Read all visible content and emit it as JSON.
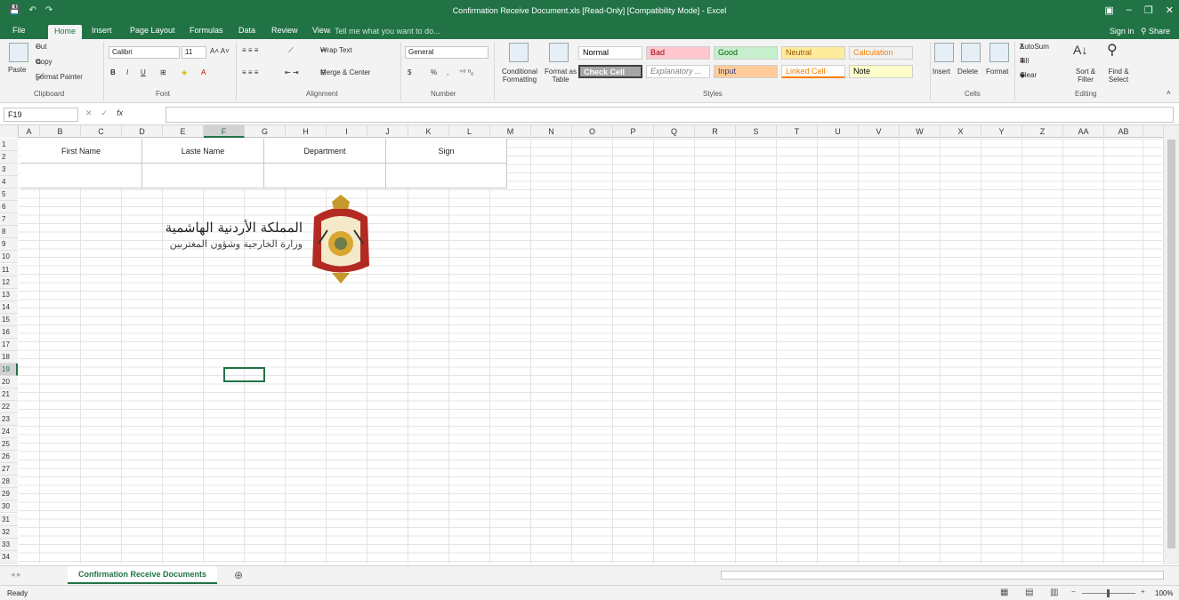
{
  "window": {
    "title": "Confirmation Receive Document.xls  [Read-Only]  [Compatibility Mode] - Excel"
  },
  "qat": {
    "save": "💾",
    "undo": "↶",
    "redo": "↷"
  },
  "tabs": [
    "File",
    "Home",
    "Insert",
    "Page Layout",
    "Formulas",
    "Data",
    "Review",
    "View"
  ],
  "tell_me": "Tell me what you want to do...",
  "account": {
    "signin": "Sign in",
    "share": "Share"
  },
  "ribbon": {
    "clipboard": {
      "paste": "Paste",
      "cut": "Cut",
      "copy": "Copy",
      "format_painter": "Format Painter",
      "label": "Clipboard"
    },
    "font": {
      "name": "Calibri",
      "size": "11",
      "bold": "B",
      "italic": "I",
      "underline": "U",
      "label": "Font"
    },
    "alignment": {
      "wrap": "Wrap Text",
      "merge": "Merge & Center",
      "label": "Alignment"
    },
    "number": {
      "format": "General",
      "currency": "$",
      "percent": "%",
      "comma": ",",
      "label": "Number"
    },
    "styles_group": {
      "conditional": "Conditional Formatting",
      "format_table": "Format as Table",
      "items": [
        {
          "name": "Normal",
          "bg": "#ffffff",
          "fg": "#000000"
        },
        {
          "name": "Bad",
          "bg": "#ffc7ce",
          "fg": "#9c0006"
        },
        {
          "name": "Good",
          "bg": "#c6efce",
          "fg": "#006100"
        },
        {
          "name": "Neutral",
          "bg": "#ffeb9c",
          "fg": "#9c5700"
        },
        {
          "name": "Calculation",
          "bg": "#f2f2f2",
          "fg": "#fa7d00"
        },
        {
          "name": "Check Cell",
          "bg": "#a5a5a5",
          "fg": "#ffffff"
        },
        {
          "name": "Explanatory ...",
          "bg": "#ffffff",
          "fg": "#7f7f7f"
        },
        {
          "name": "Input",
          "bg": "#ffcc99",
          "fg": "#3f3f76"
        },
        {
          "name": "Linked Cell",
          "bg": "#ffffff",
          "fg": "#fa7d00"
        },
        {
          "name": "Note",
          "bg": "#ffffcc",
          "fg": "#000000"
        }
      ],
      "label": "Styles"
    },
    "cells": {
      "insert": "Insert",
      "delete": "Delete",
      "format": "Format",
      "label": "Cells"
    },
    "editing": {
      "autosum": "AutoSum",
      "fill": "Fill",
      "clear": "Clear",
      "sort": "Sort & Filter",
      "find": "Find & Select",
      "label": "Editing"
    }
  },
  "formula_bar": {
    "name_box": "F19",
    "fx": "fx",
    "value": ""
  },
  "columns": [
    "A",
    "B",
    "C",
    "D",
    "E",
    "F",
    "G",
    "H",
    "I",
    "J",
    "K",
    "L",
    "M",
    "N",
    "O",
    "P",
    "Q",
    "R",
    "S",
    "T",
    "U",
    "V",
    "W",
    "X",
    "Y",
    "Z",
    "AA",
    "AB"
  ],
  "rows": [
    "1",
    "2",
    "3",
    "4",
    "5",
    "6",
    "7",
    "8",
    "9",
    "10",
    "11",
    "12",
    "13",
    "14",
    "15",
    "16",
    "17",
    "18",
    "19",
    "20",
    "21",
    "22",
    "23",
    "24",
    "25",
    "26",
    "27",
    "28",
    "29",
    "30",
    "31",
    "32",
    "33",
    "34"
  ],
  "sheet": {
    "headers": [
      "First Name",
      "Laste Name",
      "Department",
      "Sign"
    ],
    "logo_text_line1": "المملكة الأردنية الهاشمية",
    "logo_text_line2": "وزارة الخارجية وشؤون المغتربين",
    "selected_cell": "F19",
    "selected_column": "F",
    "selected_row": "19"
  },
  "sheet_tabs": [
    "Confirmation Receive Documents"
  ],
  "status": {
    "ready": "Ready",
    "zoom": "100%"
  }
}
